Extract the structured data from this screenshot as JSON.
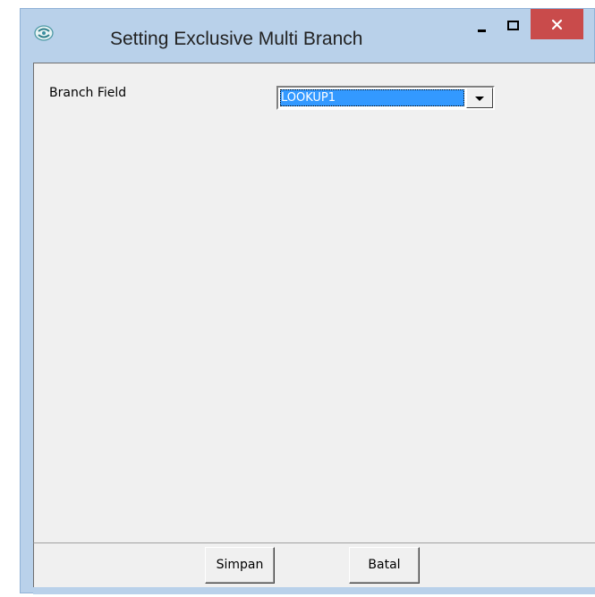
{
  "window": {
    "title": "Setting Exclusive Multi Branch",
    "app_icon": "app-logo-icon",
    "controls": {
      "minimize_icon": "minimize-icon",
      "maximize_icon": "maximize-icon",
      "close_icon": "close-icon"
    },
    "colors": {
      "frame": "#b9d1ea",
      "close_button": "#c94b4b",
      "client": "#f0f0f0",
      "selection": "#3399ff"
    }
  },
  "form": {
    "branch_field_label": "Branch Field",
    "branch_field_value": "LOOKUP1",
    "dropdown_icon": "chevron-down-icon"
  },
  "buttons": {
    "save_label": "Simpan",
    "cancel_label": "Batal"
  }
}
